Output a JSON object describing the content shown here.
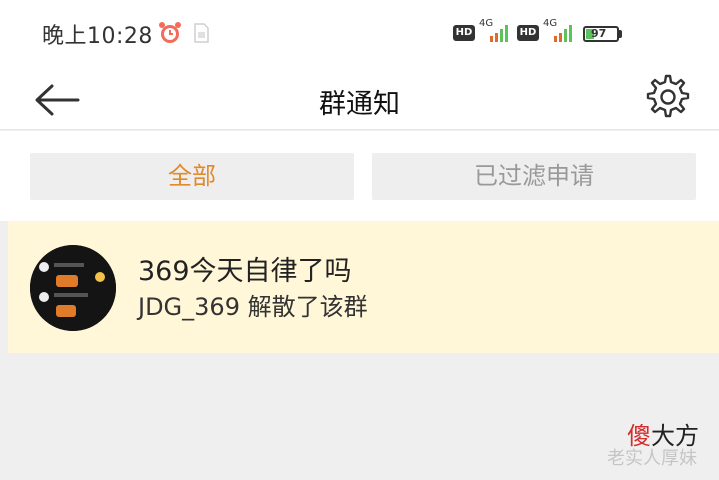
{
  "status_bar": {
    "time": "晚上10:28",
    "network1": "4G",
    "network2": "4G",
    "hd1": "HD",
    "hd2": "HD",
    "battery": "97",
    "icons": [
      "alarm-icon",
      "sim-icon",
      "signal-icon",
      "battery-icon"
    ]
  },
  "nav": {
    "title": "群通知",
    "back_icon": "arrow-left-icon",
    "settings_icon": "gear-icon"
  },
  "filters": {
    "tabs": [
      {
        "label": "全部",
        "active": true
      },
      {
        "label": "已过滤申请",
        "active": false
      }
    ]
  },
  "notices": [
    {
      "group_name": "369今天自律了吗",
      "description": "JDG_369 解散了该群"
    }
  ],
  "watermark": {
    "brand_red": "傻",
    "brand_rest": "大方",
    "sub": "老实人厚妹"
  },
  "colors": {
    "active_tab": "#e08a2c",
    "inactive_tab": "#999999",
    "notice_bg": "#fff7d8",
    "page_bg": "#efefef"
  }
}
